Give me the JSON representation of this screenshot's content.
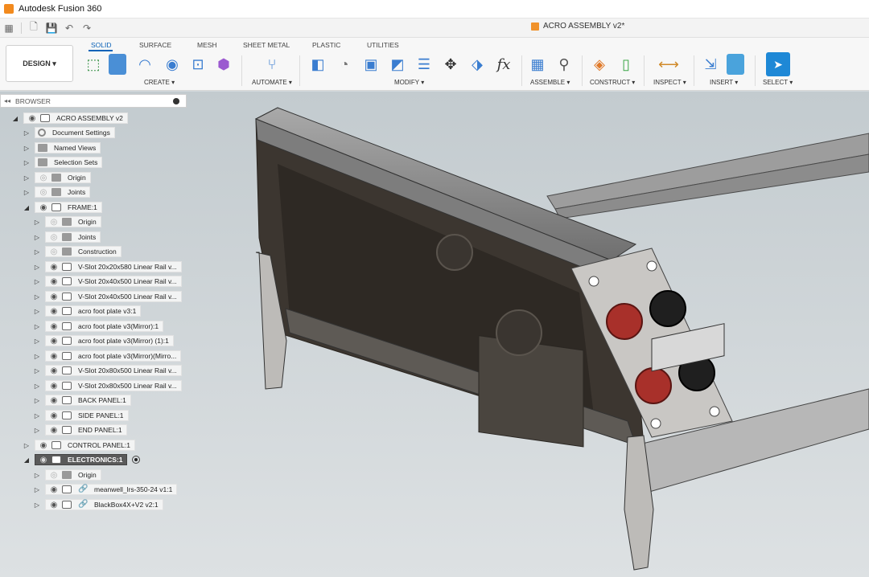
{
  "app": {
    "title": "Autodesk Fusion 360",
    "document_title": "ACRO ASSEMBLY v2*"
  },
  "workspace": {
    "label": "DESIGN ▾"
  },
  "tabs": [
    "SOLID",
    "SURFACE",
    "MESH",
    "SHEET METAL",
    "PLASTIC",
    "UTILITIES"
  ],
  "groups": [
    "CREATE ▾",
    "AUTOMATE ▾",
    "MODIFY ▾",
    "ASSEMBLE ▾",
    "CONSTRUCT ▾",
    "INSPECT ▾",
    "INSERT ▾",
    "SELECT ▾"
  ],
  "modify_fx": "fx",
  "browser": {
    "header": "BROWSER",
    "items": [
      {
        "label": "ACRO ASSEMBLY v2"
      },
      {
        "label": "Document Settings"
      },
      {
        "label": "Named Views"
      },
      {
        "label": "Selection Sets"
      },
      {
        "label": "Origin"
      },
      {
        "label": "Joints"
      },
      {
        "label": "FRAME:1"
      },
      {
        "label": "Origin"
      },
      {
        "label": "Joints"
      },
      {
        "label": "Construction"
      },
      {
        "label": "V-Slot 20x20x580 Linear Rail v..."
      },
      {
        "label": "V-Slot 20x40x500 Linear Rail v..."
      },
      {
        "label": "V-Slot 20x40x500 Linear Rail v..."
      },
      {
        "label": "acro foot plate v3:1"
      },
      {
        "label": "acro foot plate v3(Mirror):1"
      },
      {
        "label": "acro foot plate v3(Mirror) (1):1"
      },
      {
        "label": "acro foot plate v3(Mirror)(Mirro..."
      },
      {
        "label": "V-Slot 20x80x500 Linear Rail v..."
      },
      {
        "label": "V-Slot 20x80x500 Linear Rail v..."
      },
      {
        "label": "BACK PANEL:1"
      },
      {
        "label": "SIDE PANEL:1"
      },
      {
        "label": "END PANEL:1"
      },
      {
        "label": "CONTROL PANEL:1"
      },
      {
        "label": "ELECTRONICS:1"
      },
      {
        "label": "Origin"
      },
      {
        "label": "meanwell_lrs-350-24 v1:1"
      },
      {
        "label": "BlackBox4X+V2 v2:1"
      }
    ]
  },
  "colors": {
    "accent": "#0a62b8",
    "viewport_top": "#c9d0d4",
    "viewport_bottom": "#dfe3e5",
    "active_row": "#5a5a5a"
  }
}
